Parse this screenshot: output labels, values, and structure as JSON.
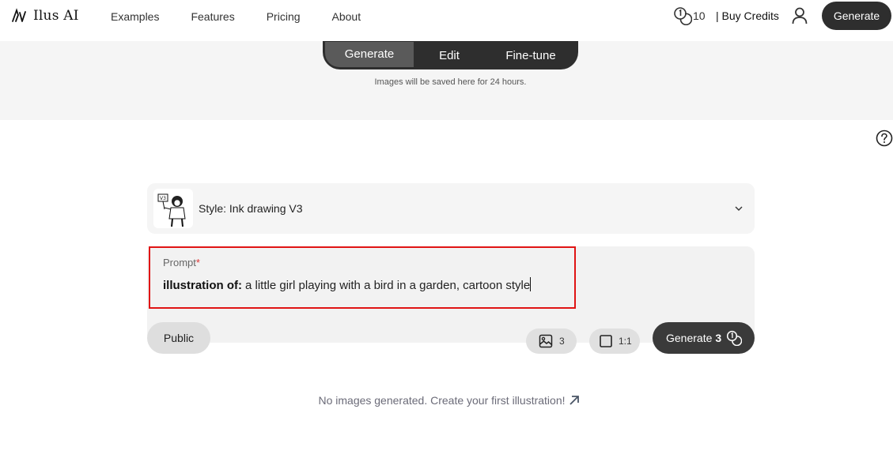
{
  "brand": {
    "name": "Ilus AI",
    "logo_icon": "ilus-logo-icon"
  },
  "nav": {
    "links": [
      "Examples",
      "Features",
      "Pricing",
      "About"
    ],
    "credits_count": "10",
    "buy_credits": "| Buy Credits",
    "generate": "Generate"
  },
  "modes": {
    "tabs": [
      "Generate",
      "Edit",
      "Fine-tune"
    ],
    "active": "Generate"
  },
  "save_note": "Images will be saved here for 24 hours.",
  "style": {
    "label": "Style: Ink drawing V3",
    "thumb_badge": "V3"
  },
  "prompt": {
    "label": "Prompt",
    "required_mark": "*",
    "prefix": "illustration of:",
    "value": "a little girl playing with a bird in a garden, cartoon style"
  },
  "controls": {
    "visibility": "Public",
    "image_count": "3",
    "aspect_ratio": "1:1",
    "generate_label": "Generate",
    "generate_cost": "3"
  },
  "empty_message": "No images generated. Create your first illustration!",
  "colors": {
    "dark": "#2e2e2e",
    "highlight": "#e01414",
    "band": "#f5f5f5"
  }
}
